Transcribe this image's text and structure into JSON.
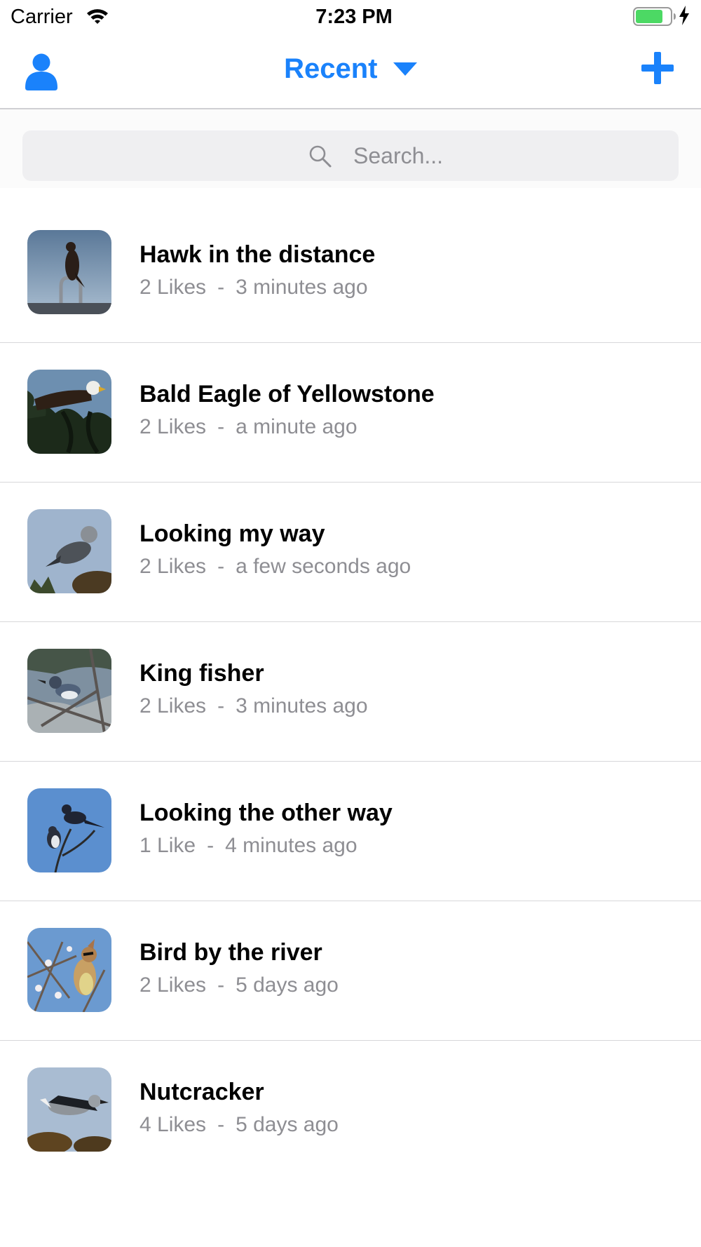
{
  "status_bar": {
    "carrier": "Carrier",
    "time": "7:23 PM",
    "battery_level": 0.8,
    "battery_color": "#4cd964"
  },
  "nav": {
    "title": "Recent",
    "accent_color": "#1a82fb",
    "left_icon": "person-icon",
    "right_icon": "plus-icon",
    "title_icon": "caret-down-icon"
  },
  "search": {
    "placeholder": "Search...",
    "value": "",
    "icon": "search-icon"
  },
  "posts": [
    {
      "title": "Hawk in the distance",
      "likes": "2 Likes",
      "separator": "-",
      "time": "3 minutes ago",
      "thumbnail": "hawk-photo"
    },
    {
      "title": "Bald Eagle of Yellowstone",
      "likes": "2 Likes",
      "separator": "-",
      "time": "a minute ago",
      "thumbnail": "bald-eagle-photo"
    },
    {
      "title": "Looking my way",
      "likes": "2 Likes",
      "separator": "-",
      "time": "a few seconds ago",
      "thumbnail": "gray-bird-photo"
    },
    {
      "title": "King fisher",
      "likes": "2 Likes",
      "separator": "-",
      "time": "3 minutes ago",
      "thumbnail": "kingfisher-photo"
    },
    {
      "title": "Looking the other way",
      "likes": "1 Like",
      "separator": "-",
      "time": "4 minutes ago",
      "thumbnail": "swallows-photo"
    },
    {
      "title": "Bird by the river",
      "likes": "2 Likes",
      "separator": "-",
      "time": "5 days ago",
      "thumbnail": "waxwing-photo"
    },
    {
      "title": "Nutcracker",
      "likes": "4 Likes",
      "separator": "-",
      "time": "5 days ago",
      "thumbnail": "nutcracker-photo"
    }
  ]
}
